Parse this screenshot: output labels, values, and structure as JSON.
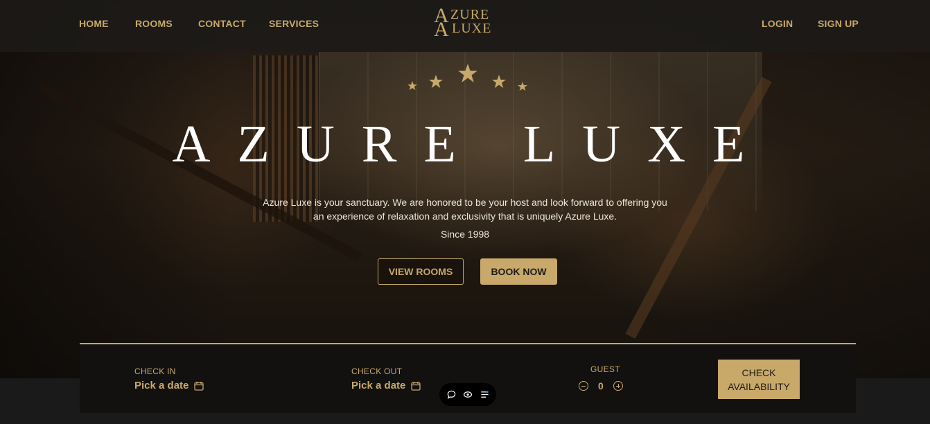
{
  "nav": {
    "left_links": [
      "HOME",
      "ROOMS",
      "CONTACT",
      "SERVICES"
    ],
    "right_links": [
      "LOGIN",
      "SIGN UP"
    ],
    "logo": {
      "line1": "AZURE",
      "line2": "LUXE"
    }
  },
  "hero": {
    "title": "AZURE LUXE",
    "description": "Azure Luxe is your sanctuary. We are honored to be your host and look forward to offering you an experience of relaxation and exclusivity that is uniquely Azure Luxe.",
    "since": "Since 1998",
    "view_rooms_label": "VIEW ROOMS",
    "book_now_label": "BOOK NOW",
    "star_count": 5
  },
  "booking": {
    "check_in_label": "CHECK IN",
    "check_in_value": "Pick a date",
    "check_out_label": "CHECK OUT",
    "check_out_value": "Pick a date",
    "guest_label": "GUEST",
    "guest_count": "0",
    "check_button_line1": "CHECK",
    "check_button_line2": "AVAILABILITY"
  },
  "widget": {
    "icons": [
      "chat-icon",
      "eye-icon",
      "settings-list-icon"
    ]
  },
  "colors": {
    "gold": "#c8a96a",
    "nav_bg": "#1c1a18",
    "booking_bg": "#121110"
  }
}
